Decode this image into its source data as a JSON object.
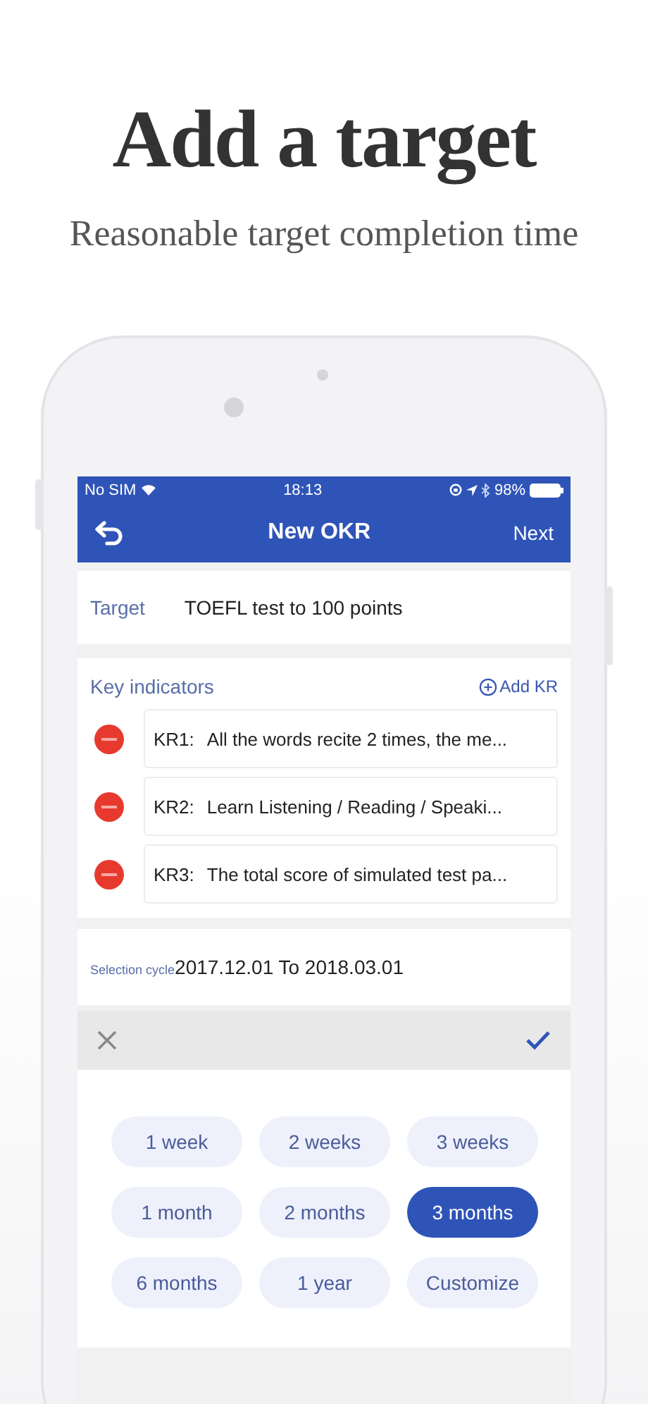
{
  "header": {
    "title": "Add a target",
    "subtitle": "Reasonable target completion time"
  },
  "status_bar": {
    "carrier": "No SIM",
    "time": "18:13",
    "battery": "98%"
  },
  "nav": {
    "title": "New OKR",
    "action": "Next"
  },
  "target": {
    "label": "Target",
    "value": "TOEFL test to 100 points"
  },
  "key_indicators": {
    "title": "Key indicators",
    "add": "Add KR",
    "items": [
      {
        "label": "KR1:",
        "text": "All the words recite 2 times, the me..."
      },
      {
        "label": "KR2:",
        "text": "Learn Listening / Reading / Speaki..."
      },
      {
        "label": "KR3:",
        "text": "The total score of simulated test pa..."
      }
    ]
  },
  "cycle": {
    "label": "Selection cycle",
    "value": "2017.12.01 To 2018.03.01"
  },
  "options": [
    {
      "label": "1 week",
      "selected": false
    },
    {
      "label": "2 weeks",
      "selected": false
    },
    {
      "label": "3 weeks",
      "selected": false
    },
    {
      "label": "1 month",
      "selected": false
    },
    {
      "label": "2 months",
      "selected": false
    },
    {
      "label": "3 months",
      "selected": true
    },
    {
      "label": "6 months",
      "selected": false
    },
    {
      "label": "1 year",
      "selected": false
    },
    {
      "label": "Customize",
      "selected": false
    }
  ]
}
